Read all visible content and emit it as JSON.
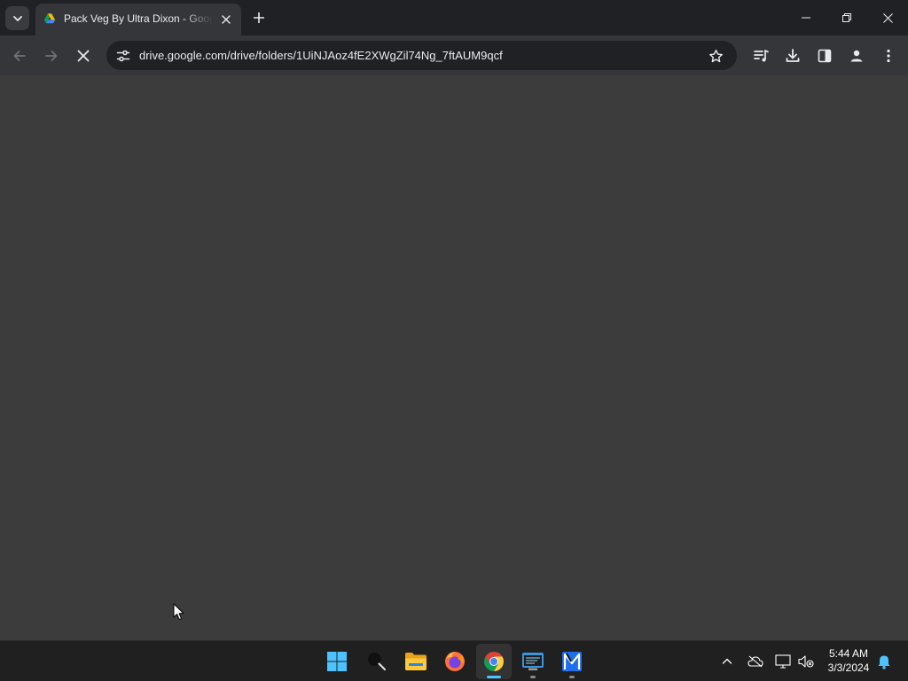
{
  "browser": {
    "tab": {
      "title": "Pack Veg By Ultra Dixon - Google Drive",
      "favicon": "google-drive-icon"
    },
    "address_bar": {
      "url": "drive.google.com/drive/folders/1UiNJAoz4fE2XWgZil74Ng_7ftAUM9qcf"
    },
    "nav": {
      "back": "back-arrow-icon",
      "forward": "forward-arrow-icon",
      "stop": "stop-loading-icon"
    },
    "toolbar_icons": [
      "media-controls-icon",
      "download-icon",
      "side-panel-icon",
      "profile-icon",
      "menu-icon"
    ],
    "loading": true
  },
  "taskbar": {
    "apps": [
      {
        "name": "start",
        "icon": "windows-logo-icon"
      },
      {
        "name": "search",
        "icon": "search-icon"
      },
      {
        "name": "file-explorer",
        "icon": "folder-icon"
      },
      {
        "name": "firefox",
        "icon": "firefox-icon"
      },
      {
        "name": "chrome",
        "icon": "chrome-icon",
        "active": true
      },
      {
        "name": "terminal",
        "icon": "terminal-icon"
      },
      {
        "name": "app",
        "icon": "app-icon"
      }
    ],
    "tray": {
      "time": "5:44 AM",
      "date": "3/3/2024"
    }
  },
  "colors": {
    "accent": "#4cc2ff",
    "page_background": "#3c3c3c",
    "chrome_frame": "#202124"
  }
}
